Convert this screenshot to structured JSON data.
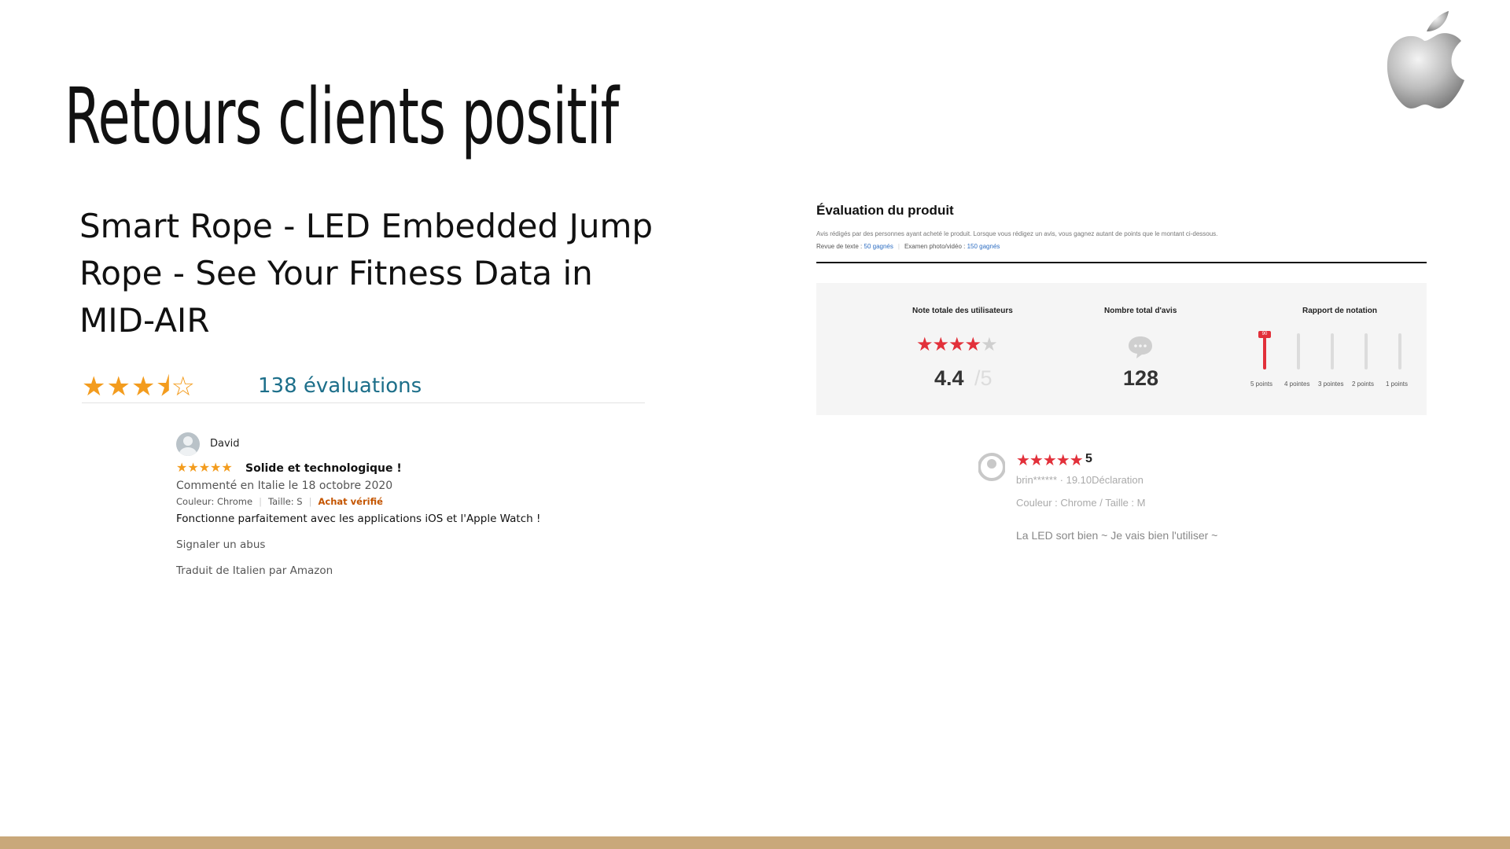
{
  "slide": {
    "title": "Retours clients positif",
    "logo": "apple-logo",
    "accent_color": "#c9a87a"
  },
  "product": {
    "title": "Smart Rope - LED Embedded Jump Rope - See Your Fitness Data in MID-AIR",
    "rating_stars": 3.5,
    "stars_text": "★★★⯨☆",
    "ratings_count_label": "138 évaluations",
    "review": {
      "reviewer": "David",
      "stars": 5,
      "stars_text": "★★★★★",
      "title": "Solide et technologique !",
      "date_line": "Commenté en Italie le 18 octobre 2020",
      "color_label": "Couleur: Chrome",
      "size_label": "Taille: S",
      "verified_label": "Achat vérifié",
      "body": "Fonctionne parfaitement avec les applications iOS et l'Apple Watch !",
      "report_label": "Signaler un abus",
      "translated_label": "Traduit de Italien par Amazon"
    }
  },
  "evaluation": {
    "header": "Évaluation du produit",
    "description": "Avis rédigés par des personnes ayant acheté le produit. Lorsque vous rédigez un avis, vous gagnez autant de points que le montant ci-dessous.",
    "text_review_label": "Revue de texte :",
    "text_review_points": "50 gagnés",
    "photo_review_label": "Examen photo/vidéo :",
    "photo_review_points": "150 gagnés",
    "col_total_rating_label": "Note totale des utilisateurs",
    "col_total_reviews_label": "Nombre total d'avis",
    "col_rating_report_label": "Rapport de notation",
    "stars_text": "★★★★",
    "star_partial": "★",
    "score": "4.4",
    "score_denominator": "/5",
    "total_reviews": "128",
    "distribution": [
      {
        "label": "5 points",
        "fraction": 0.9,
        "pct_label": "90"
      },
      {
        "label": "4 pointes",
        "fraction": 0
      },
      {
        "label": "3 pointes",
        "fraction": 0
      },
      {
        "label": "2 points",
        "fraction": 0
      },
      {
        "label": "1 points",
        "fraction": 0
      }
    ],
    "red": "#e2303a"
  },
  "right_review": {
    "stars_text": "★★★★★",
    "score": "5",
    "meta": "brin****** · 19.10Déclaration",
    "attrs": "Couleur : Chrome / Taille : M",
    "body": "La LED sort bien ~ Je vais bien l'utiliser ~"
  }
}
